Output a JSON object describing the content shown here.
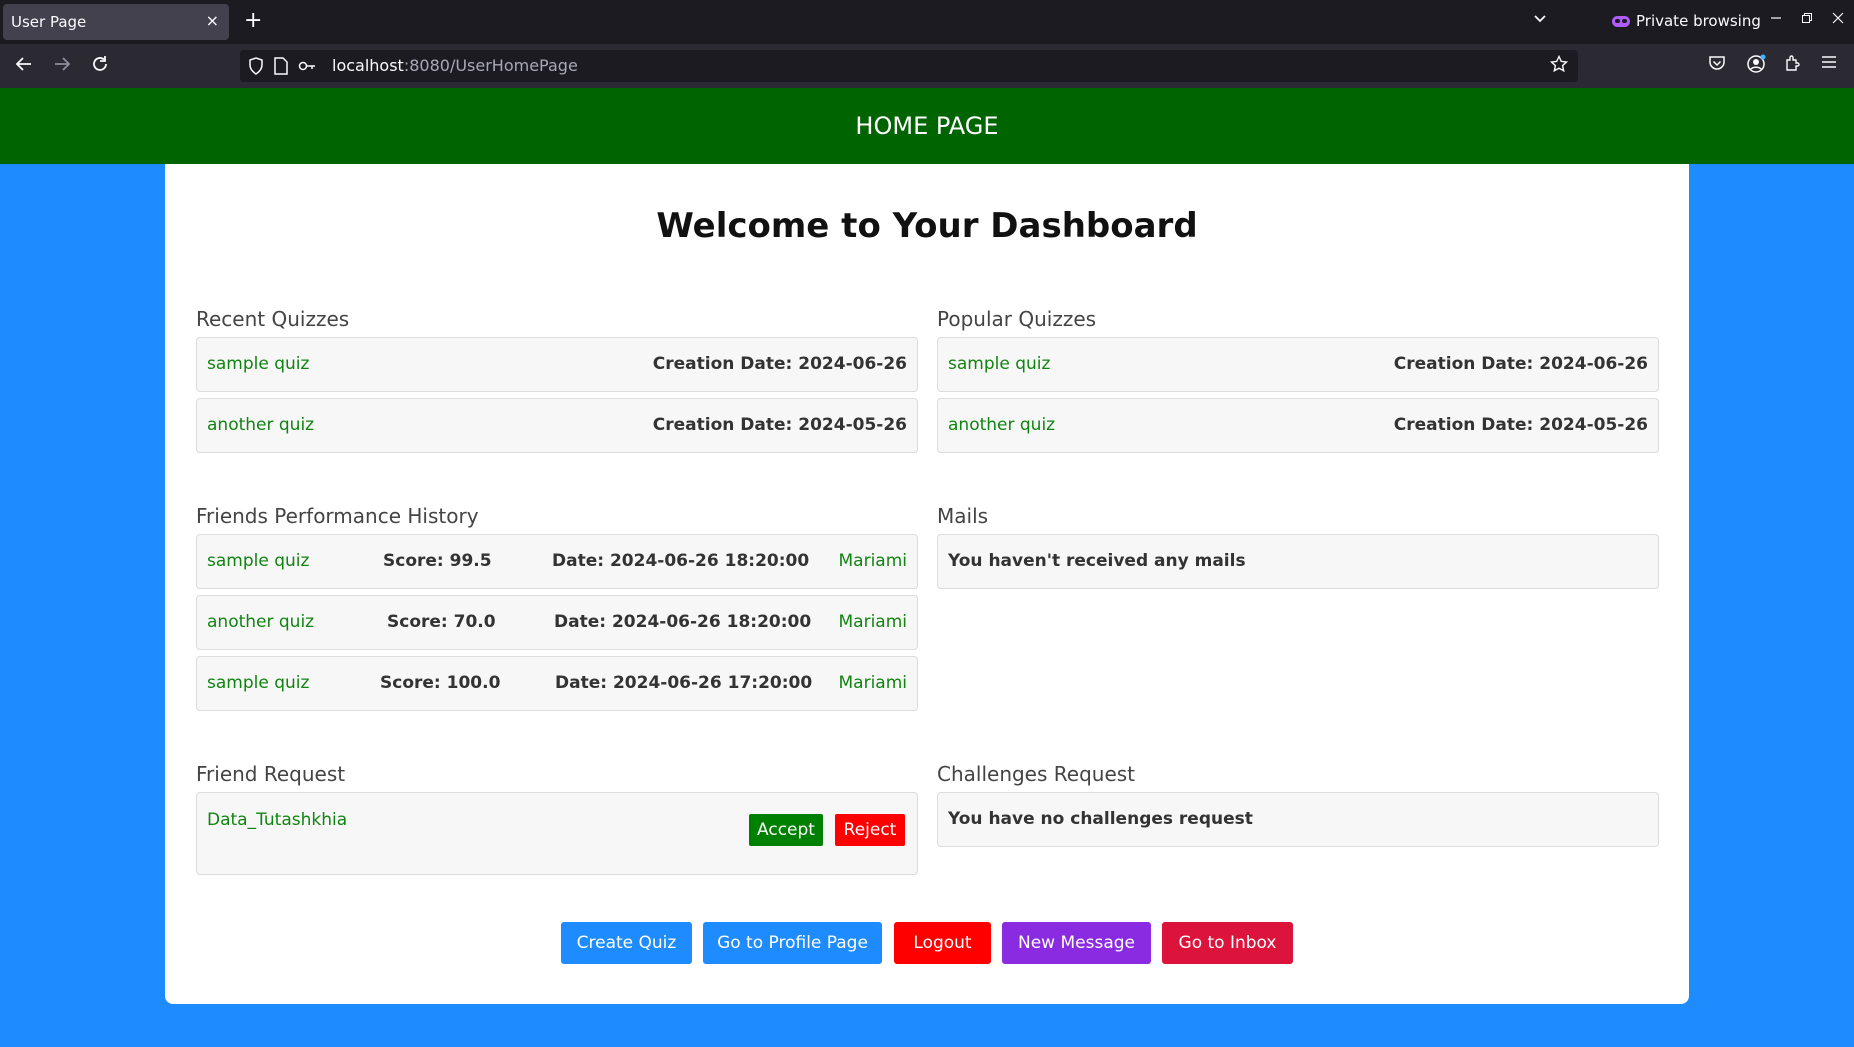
{
  "browser": {
    "tab_title": "User Page",
    "tab_close": "×",
    "new_tab": "+",
    "private_label": "Private browsing",
    "url_host": "localhost",
    "url_path": ":8080/UserHomePage"
  },
  "header": {
    "title": "HOME PAGE"
  },
  "dashboard": {
    "title": "Welcome to Your Dashboard"
  },
  "recent_quizzes": {
    "title": "Recent Quizzes",
    "items": [
      {
        "name": "sample quiz",
        "date": "Creation Date: 2024-06-26"
      },
      {
        "name": "another quiz",
        "date": "Creation Date: 2024-05-26"
      }
    ]
  },
  "popular_quizzes": {
    "title": "Popular Quizzes",
    "items": [
      {
        "name": "sample quiz",
        "date": "Creation Date: 2024-06-26"
      },
      {
        "name": "another quiz",
        "date": "Creation Date: 2024-05-26"
      }
    ]
  },
  "friends_history": {
    "title": "Friends Performance History",
    "items": [
      {
        "quiz": "sample quiz",
        "score": "Score: 99.5",
        "date": "Date: 2024-06-26 18:20:00",
        "friend": "Mariami"
      },
      {
        "quiz": "another quiz",
        "score": "Score: 70.0",
        "date": "Date: 2024-06-26 18:20:00",
        "friend": "Mariami"
      },
      {
        "quiz": "sample quiz",
        "score": "Score: 100.0",
        "date": "Date: 2024-06-26 17:20:00",
        "friend": "Mariami"
      }
    ]
  },
  "mails": {
    "title": "Mails",
    "empty_text": "You haven't received any mails"
  },
  "friend_request": {
    "title": "Friend Request",
    "name": "Data_Tutashkhia",
    "accept_label": "Accept",
    "reject_label": "Reject"
  },
  "challenges": {
    "title": "Challenges Request",
    "empty_text": "You have no challenges request"
  },
  "actions": {
    "create_quiz": "Create Quiz",
    "profile": "Go to Profile Page",
    "logout": "Logout",
    "new_message": "New Message",
    "inbox": "Go to Inbox"
  },
  "colors": {
    "background": "#1e8cff",
    "header": "#006400",
    "link_green": "#108410",
    "blue_button": "#1e8cff",
    "red_button": "#ff0000",
    "purple_button": "#8a2be2",
    "crimson_button": "#dc143c"
  }
}
